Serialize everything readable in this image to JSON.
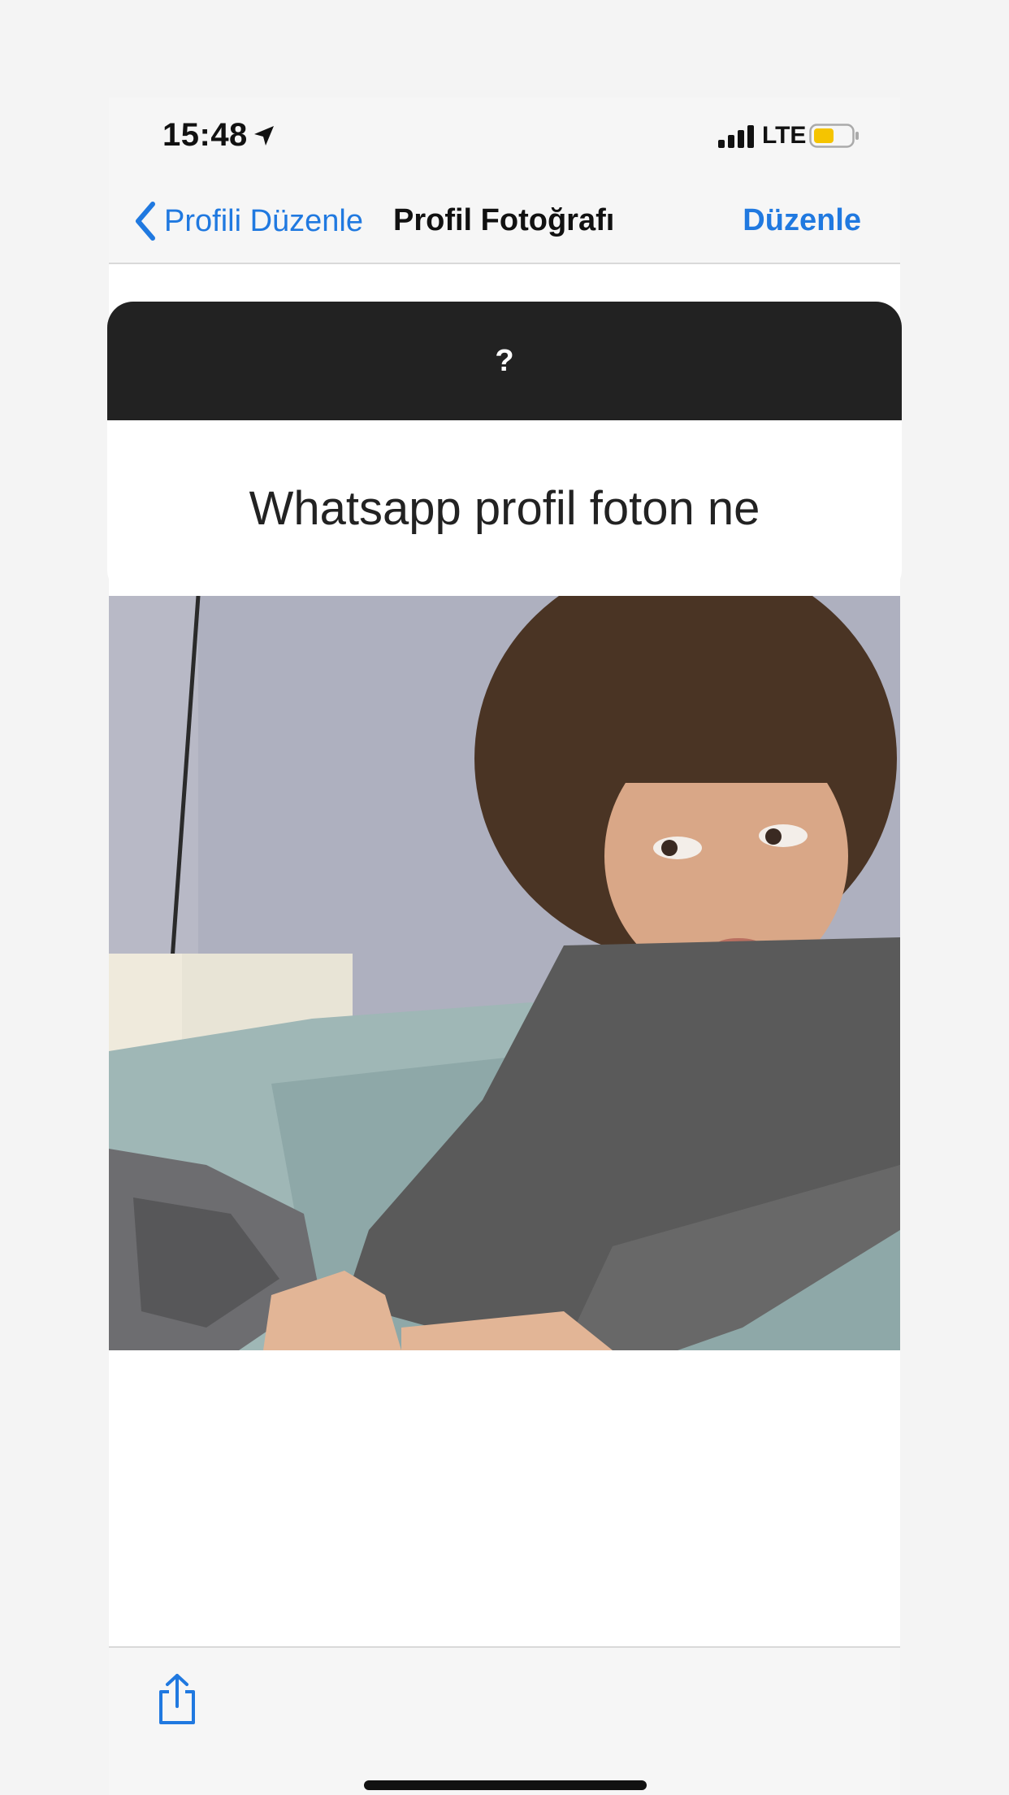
{
  "status_bar": {
    "time": "15:48",
    "network": "LTE",
    "battery_color": "#f5c400"
  },
  "nav": {
    "back_label": "Profili Düzenle",
    "title": "Profil Fotoğrafı",
    "edit_label": "Düzenle",
    "accent_color": "#2079e0"
  },
  "question_card": {
    "header": "?",
    "text": "Whatsapp profil foton ne"
  },
  "toolbar": {
    "share_icon": "share-icon"
  }
}
